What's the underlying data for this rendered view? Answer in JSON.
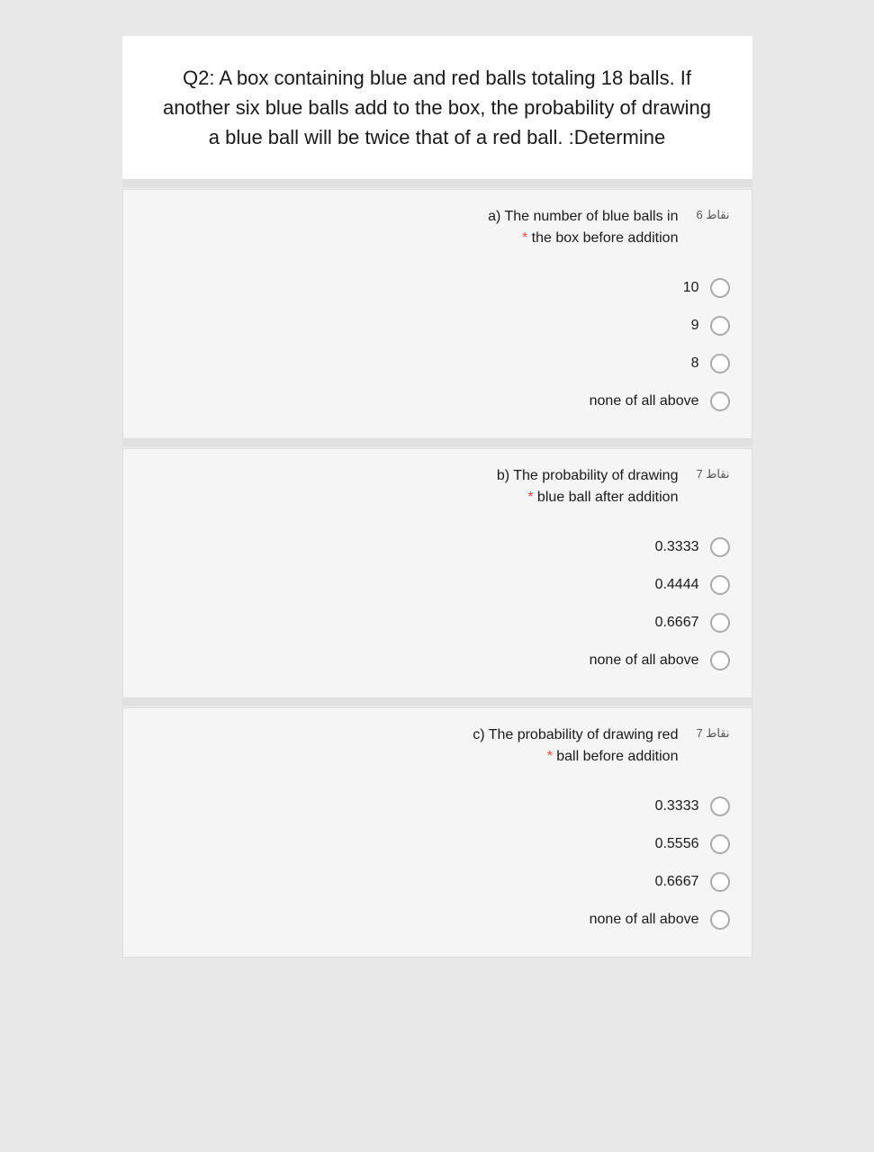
{
  "question": {
    "text": "Q2: A box containing blue and red balls totaling 18 balls. If another six blue balls add to the box, the probability of drawing a blue ball will be twice that of a red ball. :Determine"
  },
  "sub_questions": [
    {
      "id": "a",
      "points": "نقاط 6",
      "title_line1": "a) The number of blue balls in",
      "title_line2": "* the box before addition",
      "options": [
        {
          "value": "10",
          "label": "10"
        },
        {
          "value": "9",
          "label": "9"
        },
        {
          "value": "8",
          "label": "8"
        },
        {
          "value": "none",
          "label": "none of all above"
        }
      ]
    },
    {
      "id": "b",
      "points": "نقاط 7",
      "title_line1": "b) The probability of drawing",
      "title_line2": "* blue ball after addition",
      "options": [
        {
          "value": "0.3333",
          "label": "0.3333"
        },
        {
          "value": "0.4444",
          "label": "0.4444"
        },
        {
          "value": "0.6667",
          "label": "0.6667"
        },
        {
          "value": "none",
          "label": "none of all above"
        }
      ]
    },
    {
      "id": "c",
      "points": "نقاط 7",
      "title_line1": "c) The probability of drawing red",
      "title_line2": "* ball before addition",
      "options": [
        {
          "value": "0.3333",
          "label": "0.3333"
        },
        {
          "value": "0.5556",
          "label": "0.5556"
        },
        {
          "value": "0.6667",
          "label": "0.6667"
        },
        {
          "value": "none",
          "label": "none of all above"
        }
      ]
    }
  ]
}
